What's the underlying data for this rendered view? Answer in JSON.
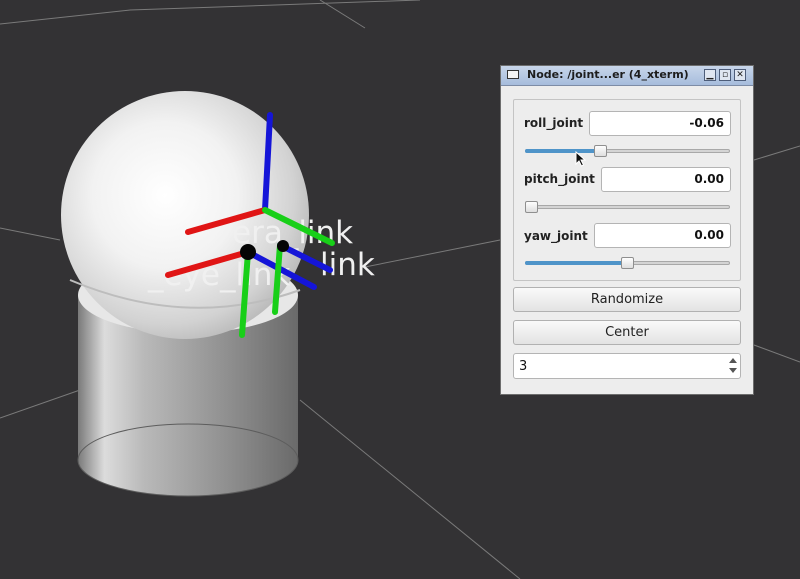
{
  "viewport": {
    "background": "#333234",
    "frame_labels": [
      {
        "text": "era_link"
      },
      {
        "text": "_eye_link"
      },
      {
        "text": "link"
      }
    ],
    "axis_colors": {
      "x": "#e01515",
      "y": "#18cf18",
      "z": "#1515d8"
    }
  },
  "window": {
    "title": "Node: /joint...er (4_xterm)",
    "controls": {
      "minimize": "▁",
      "maximize": "▫",
      "close": "✕"
    },
    "joints": [
      {
        "label": "roll_joint",
        "value": "-0.06",
        "position": 0.36
      },
      {
        "label": "pitch_joint",
        "value": "0.00",
        "position": 0.0
      },
      {
        "label": "yaw_joint",
        "value": "0.00",
        "position": 0.5
      }
    ],
    "randomize_label": "Randomize",
    "center_label": "Center",
    "spin_value": "3"
  }
}
